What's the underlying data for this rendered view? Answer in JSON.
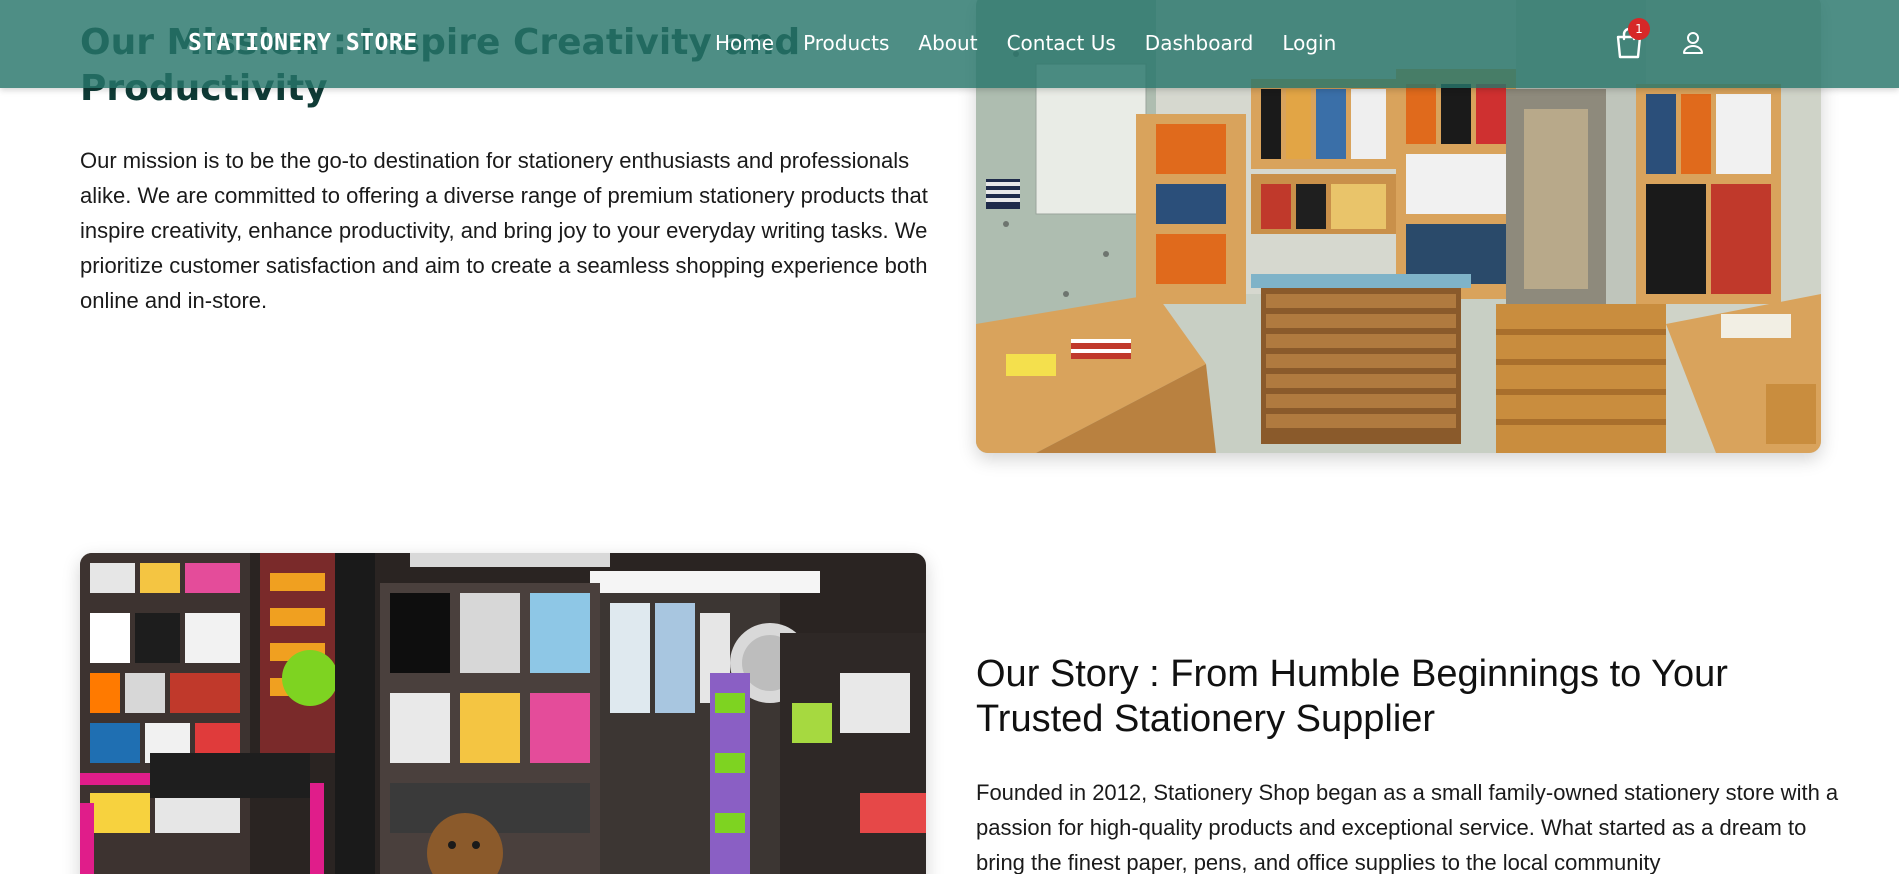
{
  "navbar": {
    "brand": "STATIONERY STORE",
    "links": [
      "Home",
      "Products",
      "About",
      "Contact Us",
      "Dashboard",
      "Login"
    ],
    "cart_count": "1",
    "cart_icon": "shopping-bag-icon",
    "user_icon": "user-icon",
    "background_color": "#27756a",
    "badge_color": "#d62828"
  },
  "mission": {
    "title": "Our Mission : Inspire Creativity and Productivity",
    "text": "Our mission is to be the go-to destination for stationery enthusiasts and professionals alike. We are committed to offering a diverse range of premium stationery products that inspire creativity, enhance productivity, and bring joy to your everyday writing tasks. We prioritize customer satisfaction and aim to create a seamless shopping experience both online and in-store."
  },
  "story": {
    "title": "Our Story : From Humble Beginnings to Your Trusted Stationery Supplier",
    "text": "Founded in 2012, Stationery Shop began as a small family-owned stationery store with a passion for high-quality products and exceptional service. What started as a dream to bring the finest paper, pens, and office supplies to the local community"
  },
  "images": {
    "mission_image": "stationery-shop-interior-image",
    "story_image": "newsstand-with-dog-image"
  }
}
